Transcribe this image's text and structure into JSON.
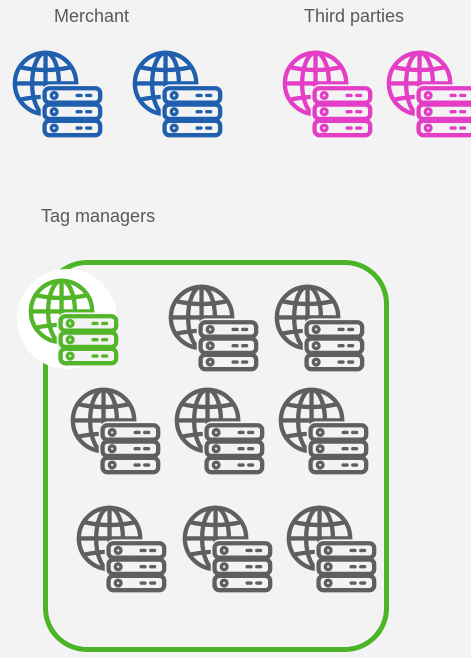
{
  "labels": {
    "merchant": "Merchant",
    "third_parties": "Third parties",
    "tag_managers": "Tag managers"
  },
  "colors": {
    "merchant": "#1f5fae",
    "third_parties": "#e43ec7",
    "tag_manager_primary": "#52b52a",
    "tag_manager_others": "#5f5f5f",
    "tag_box_border": "#4db327",
    "background": "#f3f3f3"
  },
  "icon_name": "globe-server-icon"
}
